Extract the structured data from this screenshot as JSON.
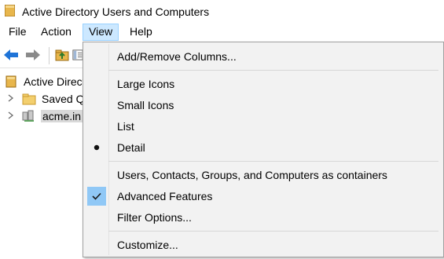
{
  "window": {
    "title": "Active Directory Users and Computers",
    "icon": "ad-folder-icon"
  },
  "menubar": {
    "items": [
      "File",
      "Action",
      "View",
      "Help"
    ],
    "active": "View"
  },
  "toolbar": {
    "icons": [
      "back-arrow-icon",
      "forward-arrow-icon",
      "folder-up-icon",
      "console-tree-icon"
    ]
  },
  "tree": {
    "items": [
      {
        "label": "Active Directo",
        "icon": "ad-root-icon"
      },
      {
        "label": "Saved Q",
        "icon": "folder-icon"
      },
      {
        "label": "acme.in",
        "icon": "domain-icon"
      }
    ]
  },
  "view_menu": {
    "items": [
      {
        "label": "Add/Remove Columns...",
        "mark": "none"
      },
      {
        "label": "Large Icons",
        "mark": "none"
      },
      {
        "label": "Small Icons",
        "mark": "none"
      },
      {
        "label": "List",
        "mark": "none"
      },
      {
        "label": "Detail",
        "mark": "radio"
      },
      {
        "label": "Users, Contacts, Groups, and Computers as containers",
        "mark": "none"
      },
      {
        "label": "Advanced Features",
        "mark": "check"
      },
      {
        "label": "Filter Options...",
        "mark": "none"
      },
      {
        "label": "Customize...",
        "mark": "none"
      }
    ]
  },
  "colors": {
    "menu_highlight": "#cce8ff",
    "check_highlight": "#90c8f6",
    "arrow_blue": "#1e73d7"
  }
}
